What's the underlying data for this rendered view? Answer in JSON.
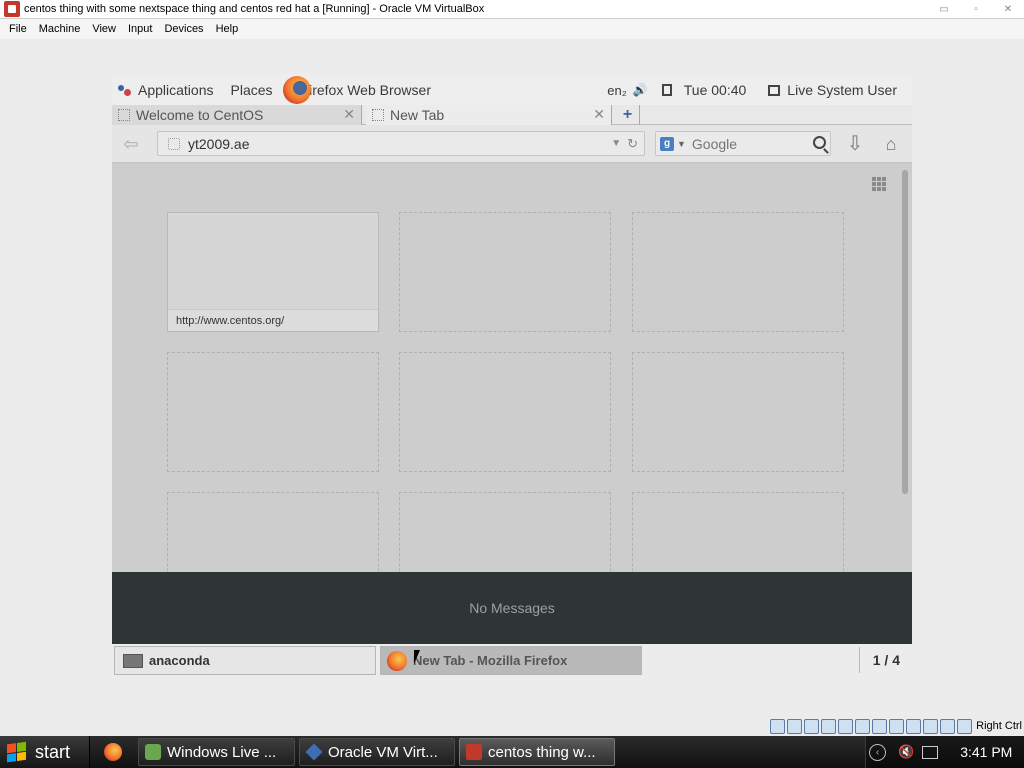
{
  "vbox": {
    "title": "centos thing with some nextspace thing and centos red hat a [Running] - Oracle VM VirtualBox",
    "window_buttons": [
      "▭",
      "▫",
      "✕"
    ],
    "menu": [
      "File",
      "Machine",
      "View",
      "Input",
      "Devices",
      "Help"
    ],
    "host_key": "Right Ctrl"
  },
  "gnome": {
    "applications": "Applications",
    "places": "Places",
    "active_app": "Firefox Web Browser",
    "keyboard": "en₂",
    "volume_icon": "🔊",
    "time": "Tue 00:40",
    "user": "Live System User",
    "message_tray": "No Messages",
    "taskbar": [
      {
        "label": "anaconda"
      },
      {
        "label": "New Tab - Mozilla Firefox"
      }
    ],
    "pager": "1 / 4"
  },
  "firefox": {
    "tabs": [
      {
        "label": "Welcome to CentOS"
      },
      {
        "label": "New Tab"
      }
    ],
    "tab_close": "✕",
    "new_tab": "+",
    "url": "yt2009.ae",
    "url_dropdown": "▼",
    "reload": "↻",
    "search_engine_letter": "g",
    "search_dropdown": "▼",
    "search_placeholder": "Google",
    "back": "⇦",
    "download": "⇩",
    "home": "⌂",
    "tiles": [
      {
        "url": "http://www.centos.org/"
      },
      {
        "url": ""
      },
      {
        "url": ""
      },
      {
        "url": ""
      },
      {
        "url": ""
      },
      {
        "url": ""
      },
      {
        "url": ""
      },
      {
        "url": ""
      },
      {
        "url": ""
      }
    ]
  },
  "windows": {
    "start": "start",
    "tasks": [
      {
        "label": "Windows Live ..."
      },
      {
        "label": "Oracle VM Virt..."
      },
      {
        "label": "centos thing w..."
      }
    ],
    "tray_chevron": "‹",
    "tray_volume": "🔇",
    "clock": "3:41 PM"
  }
}
